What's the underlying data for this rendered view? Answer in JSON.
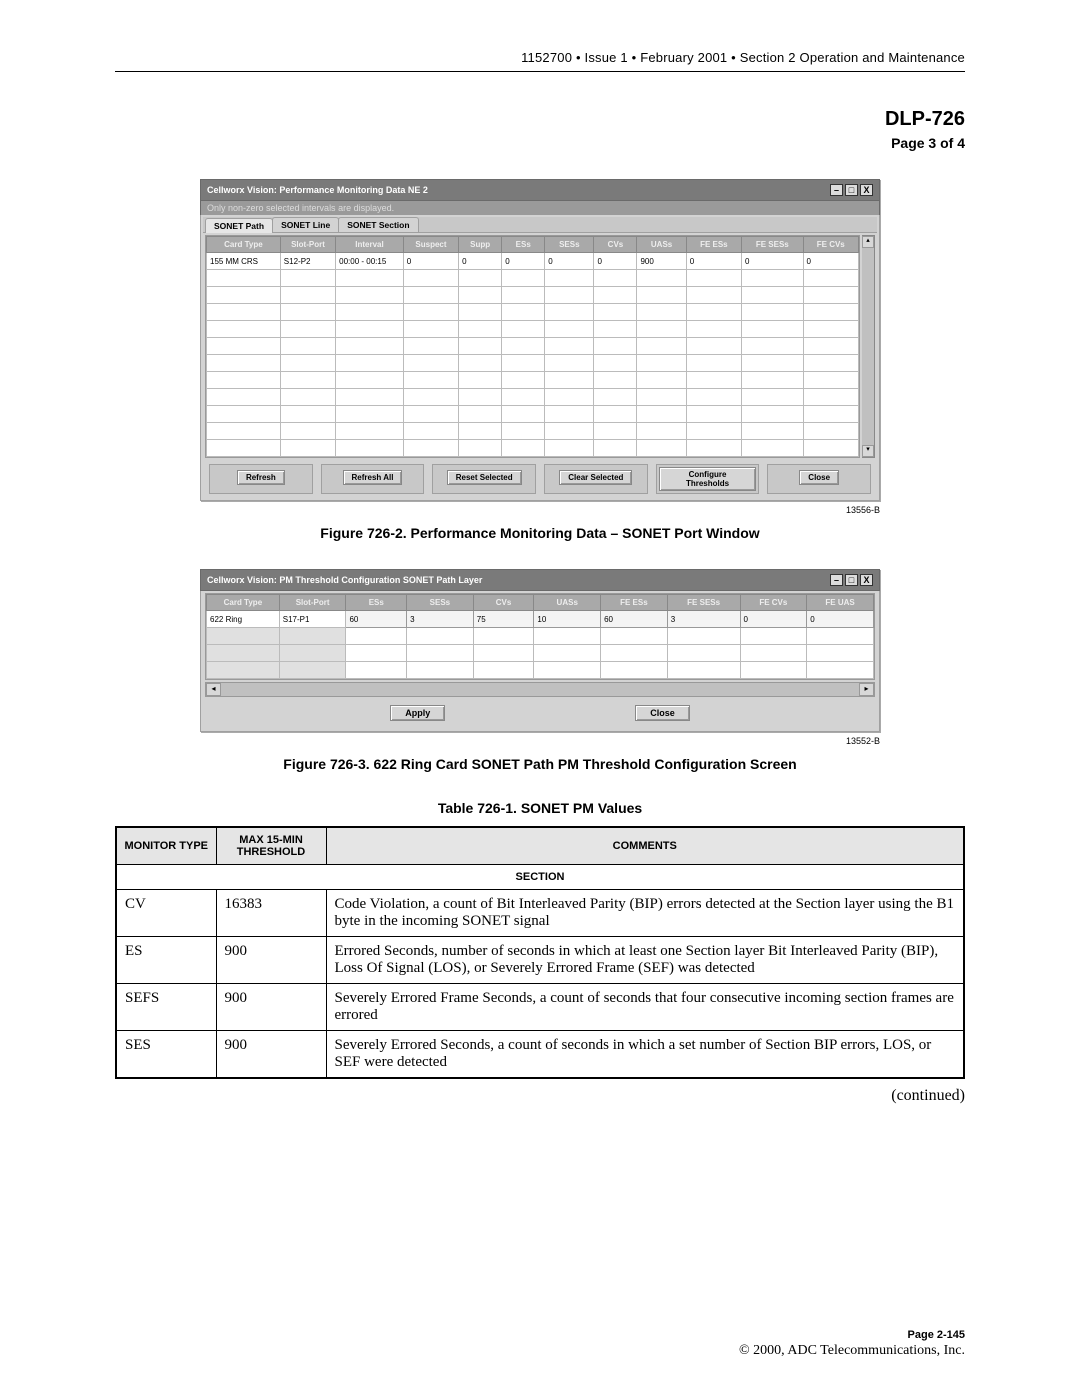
{
  "header": {
    "text": "1152700 • Issue 1 • February 2001 • Section 2 Operation and Maintenance"
  },
  "title": {
    "code": "DLP-726",
    "page": "Page 3 of 4"
  },
  "figure1": {
    "window_title": "Cellworx Vision:   Performance Monitoring Data NE 2",
    "note": "Only non-zero selected intervals are displayed.",
    "tabs": [
      "SONET Path",
      "SONET Line",
      "SONET Section"
    ],
    "columns": [
      "Card Type",
      "Slot-Port",
      "Interval",
      "Suspect",
      "Supp",
      "ESs",
      "SESs",
      "CVs",
      "UASs",
      "FE ESs",
      "FE SESs",
      "FE CVs"
    ],
    "row": {
      "card": "155 MM CRS",
      "slot": "S12-P2",
      "interval": "00:00 - 00:15",
      "suspect": "0",
      "supp": "0",
      "es": "0",
      "ses": "0",
      "cv": "0",
      "uas": "900",
      "fees": "0",
      "feses": "0",
      "fecv": "0"
    },
    "empty_rows": 11,
    "buttons": [
      "Refresh",
      "Refresh All",
      "Reset Selected",
      "Clear Selected",
      "Configure Thresholds",
      "Close"
    ],
    "id": "13556-B",
    "caption": "Figure 726-2. Performance Monitoring Data – SONET Port Window"
  },
  "figure2": {
    "window_title": "Cellworx Vision:   PM Threshold Configuration SONET Path Layer",
    "columns": [
      "Card Type",
      "Slot-Port",
      "ESs",
      "SESs",
      "CVs",
      "UASs",
      "FE ESs",
      "FE SESs",
      "FE CVs",
      "FE UAS"
    ],
    "row": {
      "card": "622 Ring",
      "slot": "S17-P1",
      "es": "60",
      "ses": "3",
      "cv": "75",
      "uas": "10",
      "fees": "60",
      "feses": "3",
      "fecv": "0",
      "feuas": "0"
    },
    "empty_rows": 3,
    "buttons": [
      "Apply",
      "Close"
    ],
    "id": "13552-B",
    "caption": "Figure 726-3. 622 Ring Card SONET Path PM Threshold Configuration Screen"
  },
  "doc_table": {
    "caption": "Table 726-1. SONET PM Values",
    "headers": [
      "MONITOR TYPE",
      "MAX 15-MIN THRESHOLD",
      "COMMENTS"
    ],
    "section": "SECTION",
    "rows": [
      {
        "m": "CV",
        "t": "16383",
        "c": "Code Violation, a count of Bit Interleaved Parity (BIP) errors detected at the Section layer using the B1 byte in the incoming SONET signal"
      },
      {
        "m": "ES",
        "t": "900",
        "c": "Errored Seconds, number of seconds in which at least one Section layer Bit Interleaved Parity (BIP), Loss Of Signal (LOS), or Severely Errored Frame (SEF) was detected"
      },
      {
        "m": "SEFS",
        "t": "900",
        "c": "Severely Errored Frame Seconds, a count of seconds that four consecutive incoming section frames are errored"
      },
      {
        "m": "SES",
        "t": "900",
        "c": "Severely Errored Seconds, a count of seconds in which a set number of Section BIP errors, LOS, or SEF were detected"
      }
    ]
  },
  "continued": "(continued)",
  "footer": {
    "page": "Page 2-145",
    "copy": "© 2000, ADC Telecommunications, Inc."
  }
}
